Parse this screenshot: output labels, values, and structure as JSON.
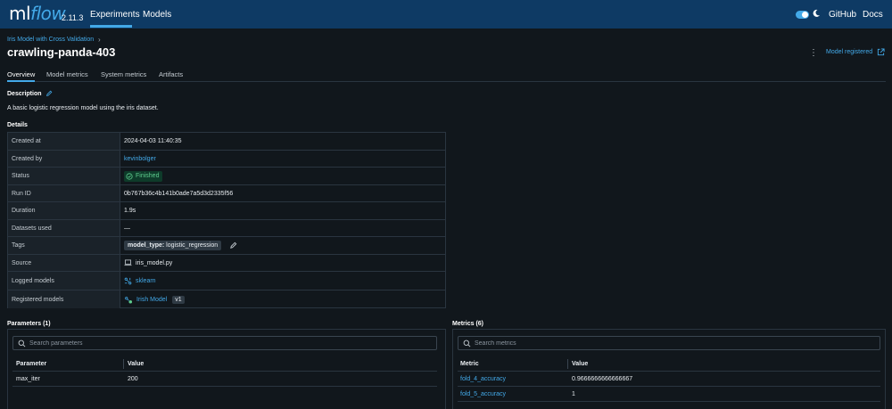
{
  "header": {
    "logo_ml": "ml",
    "logo_flow": "flow",
    "version": "2.11.3",
    "nav_experiments": "Experiments",
    "nav_models": "Models",
    "github": "GitHub",
    "docs": "Docs",
    "theme": "dark"
  },
  "breadcrumb": {
    "experiment": "Iris Model with Cross Validation",
    "separator": "›"
  },
  "run": {
    "name": "crawling-panda-403",
    "model_registered": "Model registered"
  },
  "tabs": [
    "Overview",
    "Model metrics",
    "System metrics",
    "Artifacts"
  ],
  "active_tab": "Overview",
  "description": {
    "label": "Description",
    "text": "A basic logistic regression model using the iris dataset."
  },
  "details": {
    "label": "Details",
    "rows": [
      {
        "label": "Created at",
        "value": "2024-04-03 11:40:35"
      },
      {
        "label": "Created by",
        "value": "kevinbolger"
      },
      {
        "label": "Status",
        "value": "Finished"
      },
      {
        "label": "Run ID",
        "value": "0b767b36c4b141b0ade7a5d3d2335f56"
      },
      {
        "label": "Duration",
        "value": "1.9s"
      },
      {
        "label": "Datasets used",
        "value": "—"
      },
      {
        "label": "Tags",
        "tag_key": "model_type:",
        "tag_value": " logistic_regression"
      },
      {
        "label": "Source",
        "value": "iris_model.py"
      },
      {
        "label": "Logged models",
        "value": "sklearn"
      },
      {
        "label": "Registered models",
        "value": "Irish Model",
        "version": "v1"
      }
    ]
  },
  "parameters": {
    "label": "Parameters (1)",
    "search_placeholder": "Search parameters",
    "columns": [
      "Parameter",
      "Value"
    ],
    "rows": [
      {
        "name": "max_iter",
        "value": "200"
      }
    ]
  },
  "metrics": {
    "label": "Metrics (6)",
    "search_placeholder": "Search metrics",
    "columns": [
      "Metric",
      "Value"
    ],
    "rows": [
      {
        "name": "fold_4_accuracy",
        "value": "0.9666666666666667"
      },
      {
        "name": "fold_5_accuracy",
        "value": "1"
      }
    ]
  },
  "colors": {
    "header_bg": "#0e3a64",
    "accent": "#43a9e8",
    "page_bg": "#11171c",
    "success": "#5ecb8e"
  }
}
